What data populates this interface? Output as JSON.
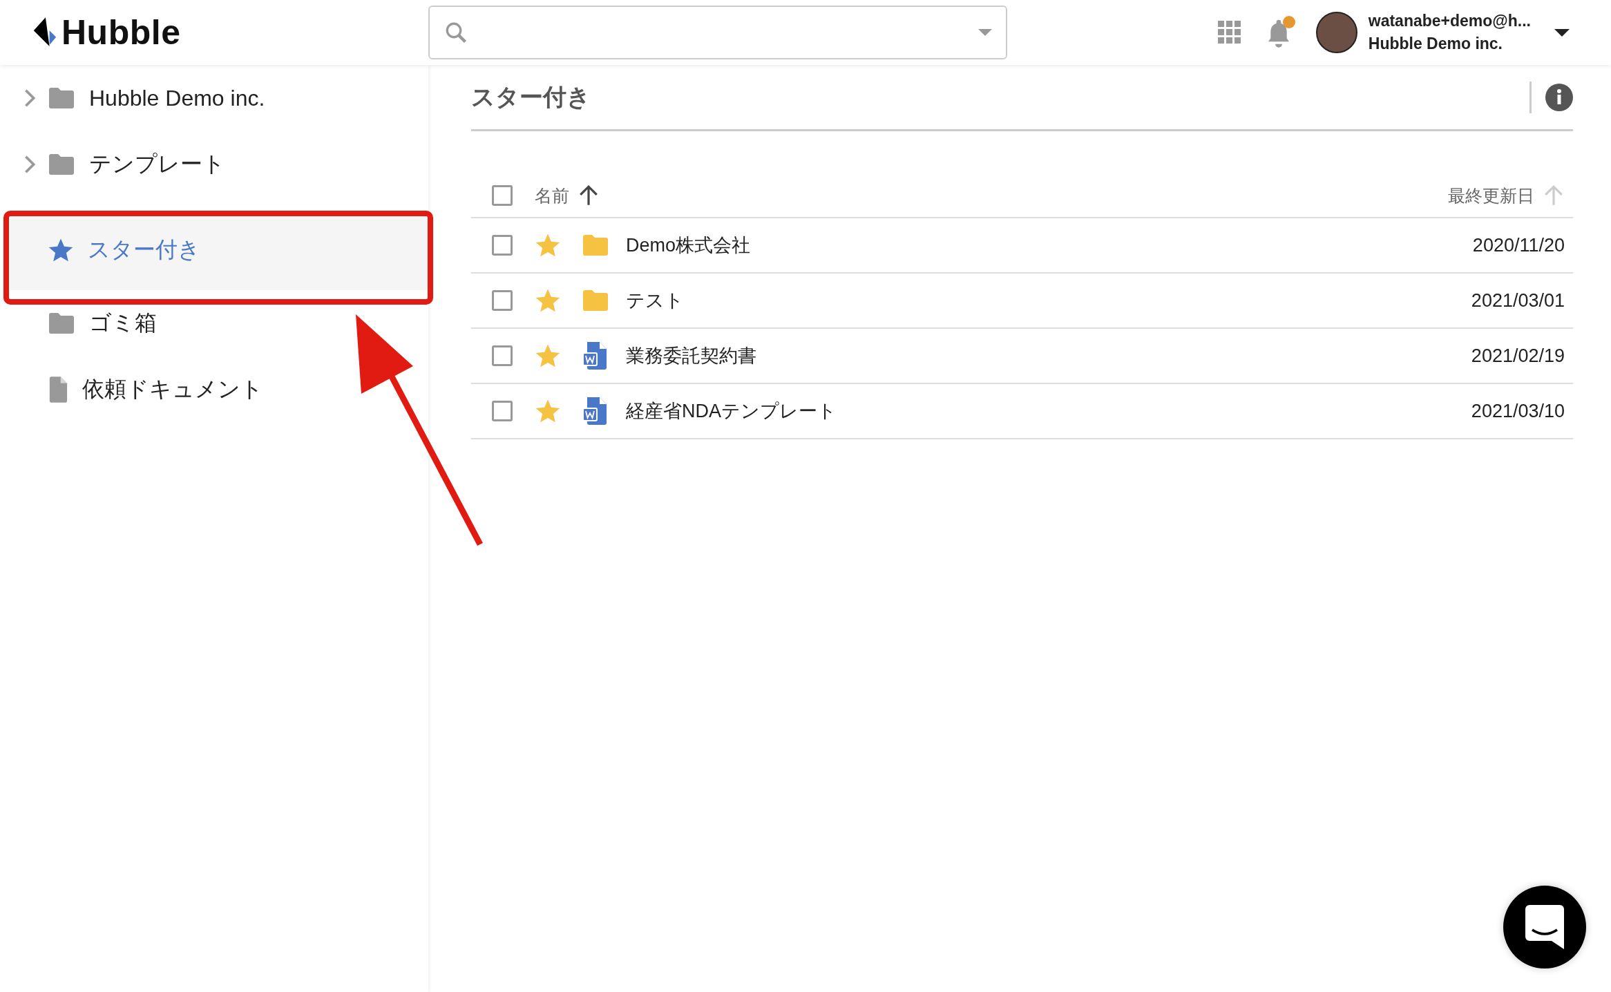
{
  "header": {
    "logo": "Hubble",
    "notifications": {
      "unread": true
    },
    "user": {
      "email": "watanabe+demo@h...",
      "company": "Hubble Demo inc."
    }
  },
  "sidebar": {
    "items": [
      {
        "label": "Hubble Demo inc.",
        "kind": "folder",
        "expandable": true,
        "selected": false
      },
      {
        "label": "テンプレート",
        "kind": "folder",
        "expandable": true,
        "selected": false
      },
      {
        "label": "スター付き",
        "kind": "star",
        "expandable": false,
        "selected": true
      },
      {
        "label": "ゴミ箱",
        "kind": "folder",
        "expandable": false,
        "selected": false
      },
      {
        "label": "依頼ドキュメント",
        "kind": "file",
        "expandable": false,
        "selected": false
      }
    ]
  },
  "main": {
    "title": "スター付き",
    "table": {
      "select_all": {
        "checked": false
      },
      "columns": [
        {
          "label": "名前",
          "sorted": true
        },
        {
          "label": "最終更新日",
          "sorted": false
        }
      ],
      "rows": [
        {
          "name": "Demo株式会社",
          "kind": "folder",
          "starred": true,
          "checked": false,
          "date": "2020/11/20"
        },
        {
          "name": "テスト",
          "kind": "folder",
          "starred": true,
          "checked": false,
          "date": "2021/03/01"
        },
        {
          "name": "業務委託契約書",
          "kind": "word",
          "starred": true,
          "checked": false,
          "date": "2021/02/19"
        },
        {
          "name": "経産省NDAテンプレート",
          "kind": "word",
          "starred": true,
          "checked": false,
          "date": "2021/03/10"
        }
      ]
    }
  },
  "annotation": {
    "highlight": true,
    "arrow": true
  }
}
